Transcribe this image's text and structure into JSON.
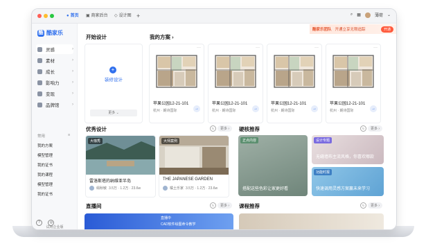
{
  "window": {
    "tabs": [
      {
        "label": "首页",
        "icon": "home-icon",
        "active": true
      },
      {
        "label": "商家后台",
        "icon": "shop-icon",
        "active": false
      },
      {
        "label": "设计图",
        "icon": "design-icon",
        "active": false
      }
    ],
    "add_tab": "+",
    "user": {
      "name": "薄荷"
    }
  },
  "sidebar": {
    "logo": "酷家乐",
    "items": [
      {
        "label": "灵感",
        "icon": "inspiration-icon"
      },
      {
        "label": "素材",
        "icon": "material-icon"
      },
      {
        "label": "成长",
        "icon": "growth-icon"
      },
      {
        "label": "影响力",
        "icon": "influence-icon"
      },
      {
        "label": "变现",
        "icon": "monetize-icon"
      },
      {
        "label": "品牌馆",
        "icon": "brand-icon"
      }
    ],
    "common_label": "常用",
    "common_items": [
      "我的方案",
      "模型管理",
      "我的证书",
      "我的课程",
      "模型管理",
      "我的证书"
    ],
    "enterprise": "试用企业版"
  },
  "banner": {
    "tag": "酷家乐团队",
    "text": "开通立享无限追踪",
    "button": "开通"
  },
  "start": {
    "heading": "开始设计",
    "button": "装修设计",
    "more": "更多"
  },
  "plans": {
    "heading": "我的方案",
    "items": [
      {
        "name": "苹果公园12-21-101",
        "city": "杭州 · 朗诗国际"
      },
      {
        "name": "苹果公园12-21-101",
        "city": "杭州 · 朗诗国际"
      },
      {
        "name": "苹果公园12-21-101",
        "city": "杭州 · 朗诗国际"
      },
      {
        "name": "苹果公园12-21-101",
        "city": "杭州 · 朗诗国际"
      }
    ]
  },
  "excellent": {
    "heading": "优秀设计",
    "more": "更多",
    "items": [
      {
        "tag": "大咖秀",
        "title": "雷洛斯塔的纳维亚半岛",
        "author": "绢秋敏",
        "stats": "3.5万 · 1.2万 · 23.6w"
      },
      {
        "tag": "大师案例",
        "title": "THE JAPANESE GARDEN",
        "author": "橘土乐家",
        "stats": "3.5万 · 1.2万 · 23.6w"
      }
    ]
  },
  "hard": {
    "heading": "硬核推荐",
    "more": "更多",
    "items": [
      {
        "tag": "正点内容",
        "text": "搭配这些色彩让家更好看"
      },
      {
        "tag": "设计专题",
        "text": "无缝墙布主流风格，你喜欢哪款"
      },
      {
        "tag": "功能时报",
        "text": "快速调用灵感方案赢未来学习"
      }
    ]
  },
  "live": {
    "heading": "直播间",
    "more": "更多",
    "tag": "直播中",
    "title": "CAD软件绘图命令教学"
  },
  "courses": {
    "heading": "课程推荐",
    "more": "更多"
  }
}
